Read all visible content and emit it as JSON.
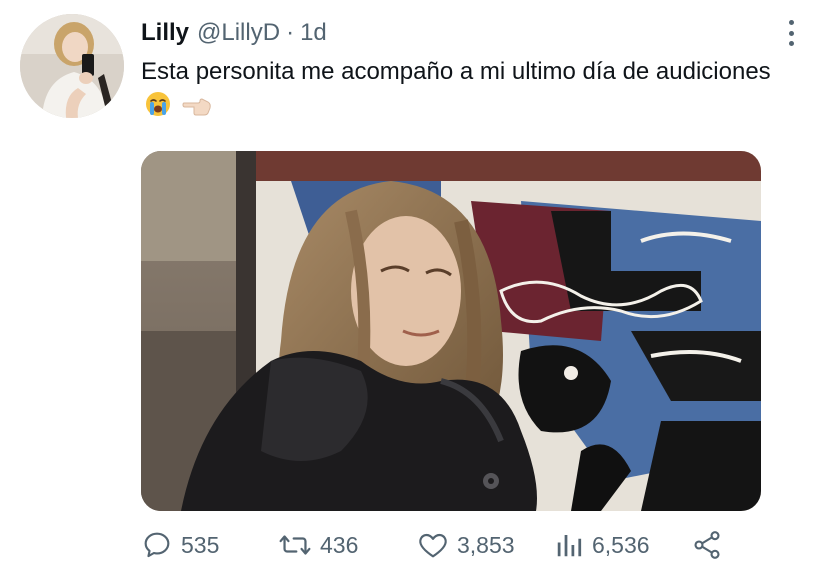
{
  "tweet": {
    "display_name": "Lilly",
    "handle": "@LillyD",
    "separator": "·",
    "time": "1d",
    "text": "Esta personita me acompaño a mi ultimo día de audiciones",
    "emojis": [
      "crying-face-emoji",
      "left-pointing-hand-emoji"
    ],
    "more_icon": "more-vertical-icon"
  },
  "actions": {
    "reply": {
      "icon": "speech-bubble-icon",
      "count": "535"
    },
    "retweet": {
      "icon": "retweet-arrows-icon",
      "count": "436"
    },
    "like": {
      "icon": "heart-icon",
      "count": "3,853"
    },
    "views": {
      "icon": "bar-chart-icon",
      "count": "6,536"
    },
    "share": {
      "icon": "share-icon"
    }
  },
  "colors": {
    "text": "#0f1419",
    "secondary": "#536471",
    "background": "#ffffff"
  }
}
